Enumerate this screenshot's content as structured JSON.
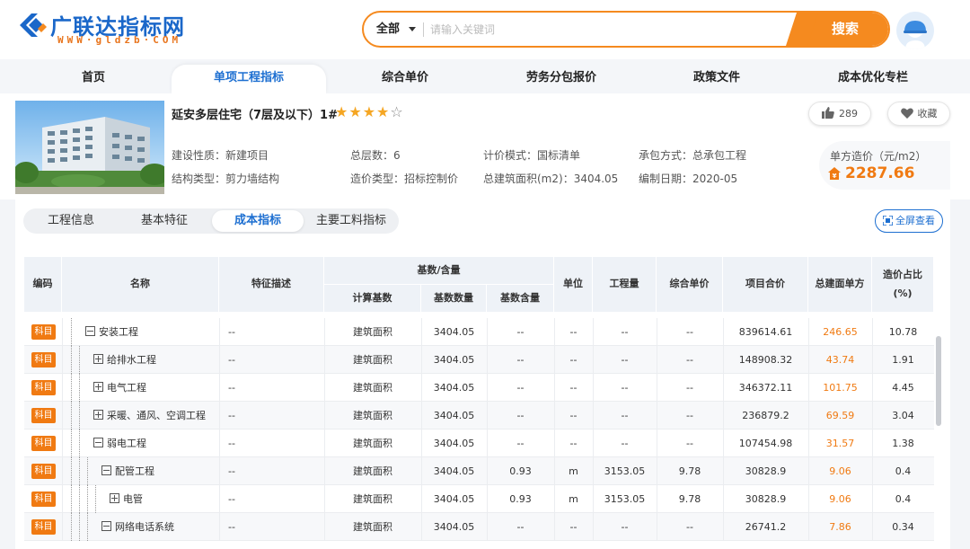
{
  "header": {
    "logo_title": "广联达指标网",
    "logo_url": "WWW·gldzb·COM",
    "search_category": "全部",
    "search_placeholder": "请输入关键词",
    "search_button": "搜索",
    "logo_icon": "glodon-logo-icon",
    "avatar_icon": "user-avatar-icon"
  },
  "nav": {
    "items": [
      {
        "label": "首页",
        "active": false
      },
      {
        "label": "单项工程指标",
        "active": true
      },
      {
        "label": "综合单价",
        "active": false
      },
      {
        "label": "劳务分包报价",
        "active": false
      },
      {
        "label": "政策文件",
        "active": false
      },
      {
        "label": "成本优化专栏",
        "active": false
      }
    ]
  },
  "project": {
    "name": "延安多层住宅（7层及以下）1#",
    "stars_filled": 4,
    "stars_total": 5,
    "likes": "289",
    "favorite_label": "收藏",
    "meta": {
      "nature": "建设性质：新建项目",
      "structure": "结构类型：剪力墙结构",
      "floors": "总层数：6",
      "cost_type": "造价类型：招标控制价",
      "pricing_mode": "计价模式：国标清单",
      "area": "总建筑面积(m2)：3404.05",
      "contract": "承包方式：总承包工程",
      "date": "编制日期：2020-05"
    },
    "unit_price_label": "单方造价（元/m2）",
    "unit_price_value": "2287.66"
  },
  "tabs": {
    "items": [
      {
        "label": "工程信息",
        "active": false
      },
      {
        "label": "基本特征",
        "active": false
      },
      {
        "label": "成本指标",
        "active": true
      },
      {
        "label": "主要工料指标",
        "active": false
      }
    ],
    "fullscreen_label": "全屏查看"
  },
  "table": {
    "headers": {
      "code": "编码",
      "name": "名称",
      "feature": "特征描述",
      "base_group": "基数/含量",
      "base_calc": "计算基数",
      "base_qty": "基数数量",
      "base_content": "基数含量",
      "unit": "单位",
      "quantity": "工程量",
      "unit_price": "综合单价",
      "total": "项目合价",
      "per_area": "总建面单方",
      "ratio_line1": "造价占比",
      "ratio_line2": "(%)"
    },
    "badge_label": "科目",
    "accent_color": "#f07a12",
    "rows": [
      {
        "name": "安装工程",
        "level": 0,
        "expanded": true,
        "feature": "--",
        "base_calc": "建筑面积",
        "base_qty": "3404.05",
        "base_content": "--",
        "unit": "--",
        "quantity": "--",
        "unit_price": "--",
        "total": "839614.61",
        "per_area": "246.65",
        "ratio": "10.78"
      },
      {
        "name": "给排水工程",
        "level": 1,
        "expanded": false,
        "feature": "--",
        "base_calc": "建筑面积",
        "base_qty": "3404.05",
        "base_content": "--",
        "unit": "--",
        "quantity": "--",
        "unit_price": "--",
        "total": "148908.32",
        "per_area": "43.74",
        "ratio": "1.91"
      },
      {
        "name": "电气工程",
        "level": 1,
        "expanded": false,
        "feature": "--",
        "base_calc": "建筑面积",
        "base_qty": "3404.05",
        "base_content": "--",
        "unit": "--",
        "quantity": "--",
        "unit_price": "--",
        "total": "346372.11",
        "per_area": "101.75",
        "ratio": "4.45"
      },
      {
        "name": "采暖、通风、空调工程",
        "level": 1,
        "expanded": false,
        "feature": "--",
        "base_calc": "建筑面积",
        "base_qty": "3404.05",
        "base_content": "--",
        "unit": "--",
        "quantity": "--",
        "unit_price": "--",
        "total": "236879.2",
        "per_area": "69.59",
        "ratio": "3.04"
      },
      {
        "name": "弱电工程",
        "level": 1,
        "expanded": true,
        "feature": "--",
        "base_calc": "建筑面积",
        "base_qty": "3404.05",
        "base_content": "--",
        "unit": "--",
        "quantity": "--",
        "unit_price": "--",
        "total": "107454.98",
        "per_area": "31.57",
        "ratio": "1.38"
      },
      {
        "name": "配管工程",
        "level": 2,
        "expanded": true,
        "feature": "--",
        "base_calc": "建筑面积",
        "base_qty": "3404.05",
        "base_content": "0.93",
        "unit": "m",
        "quantity": "3153.05",
        "unit_price": "9.78",
        "total": "30828.9",
        "per_area": "9.06",
        "ratio": "0.4"
      },
      {
        "name": "电管",
        "level": 3,
        "expanded": false,
        "feature": "--",
        "base_calc": "建筑面积",
        "base_qty": "3404.05",
        "base_content": "0.93",
        "unit": "m",
        "quantity": "3153.05",
        "unit_price": "9.78",
        "total": "30828.9",
        "per_area": "9.06",
        "ratio": "0.4"
      },
      {
        "name": "网络电话系统",
        "level": 2,
        "expanded": true,
        "feature": "--",
        "base_calc": "建筑面积",
        "base_qty": "3404.05",
        "base_content": "--",
        "unit": "--",
        "quantity": "--",
        "unit_price": "--",
        "total": "26741.2",
        "per_area": "7.86",
        "ratio": "0.34"
      }
    ]
  }
}
